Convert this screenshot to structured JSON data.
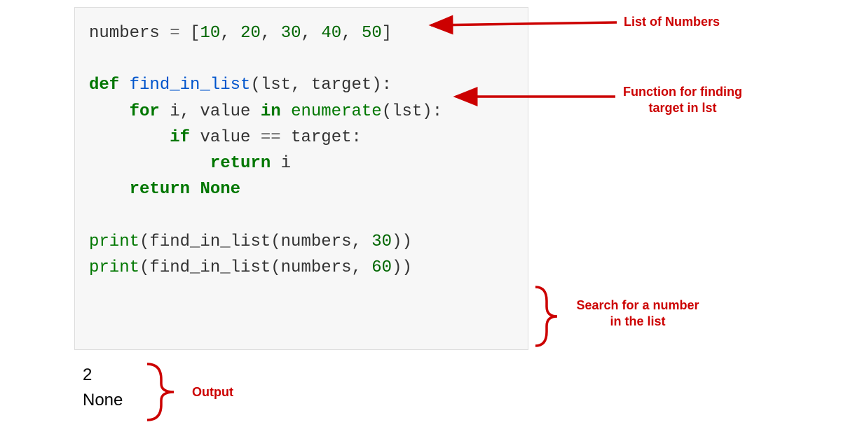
{
  "code": {
    "line1": {
      "var": "numbers",
      "op": " = ",
      "b1": "[",
      "n1": "10",
      "c": ", ",
      "n2": "20",
      "n3": "30",
      "n4": "40",
      "n5": "50",
      "b2": "]"
    },
    "line2": {
      "kw": "def ",
      "fn": "find_in_list",
      "args": "(lst, target):"
    },
    "line3": {
      "indent1": "    ",
      "kw": "for ",
      "vars": "i, value ",
      "kw2": "in ",
      "builtin": "enumerate",
      "args": "(lst):"
    },
    "line4": {
      "indent2": "        ",
      "kw": "if ",
      "var": "value ",
      "op": "== ",
      "var2": "target:"
    },
    "line5": {
      "indent3": "            ",
      "kw": "return ",
      "var": "i"
    },
    "line6": {
      "indent1": "    ",
      "kw": "return ",
      "none": "None"
    },
    "line7": {
      "builtin": "print",
      "p1": "(",
      "fn": "find_in_list",
      "args": "(numbers, ",
      "num": "30",
      "p2": "))"
    },
    "line8": {
      "builtin": "print",
      "p1": "(",
      "fn": "find_in_list",
      "args": "(numbers, ",
      "num": "60",
      "p2": "))"
    }
  },
  "output": {
    "line1": "2",
    "line2": "None"
  },
  "annotations": {
    "list_of_numbers": "List of Numbers",
    "function_for_finding": "Function for finding target in lst",
    "search_for_number": "Search for a number in the list",
    "output_label": "Output"
  }
}
